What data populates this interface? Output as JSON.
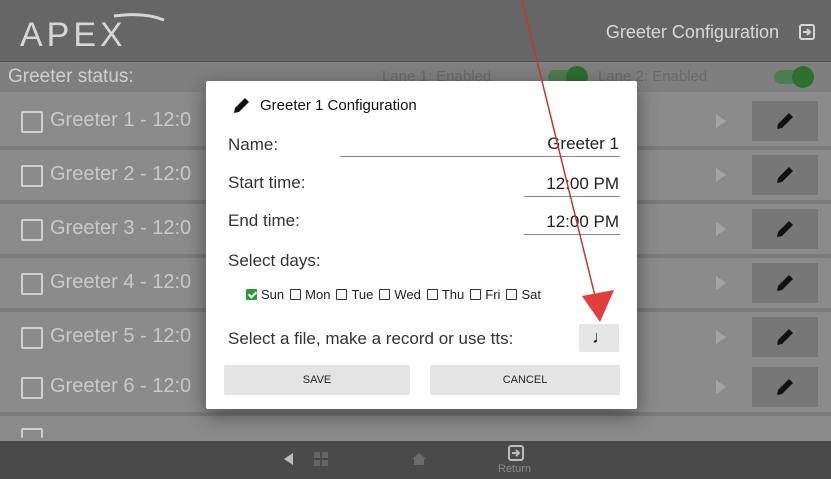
{
  "app": {
    "logo_text": "APEX",
    "title": "Greeter Configuration"
  },
  "status": {
    "label": "Greeter status:",
    "lane1": "Lane 1: Enabled",
    "lane2": "Lane 2: Enabled"
  },
  "greeters": [
    {
      "label": "Greeter 1 - 12:0"
    },
    {
      "label": "Greeter 2 - 12:0"
    },
    {
      "label": "Greeter 3 - 12:0"
    },
    {
      "label": "Greeter 4 - 12:0"
    },
    {
      "label": "Greeter 5 - 12:0"
    },
    {
      "label": "Greeter 6 - 12:0"
    }
  ],
  "dialog": {
    "title": "Greeter 1 Configuration",
    "name_label": "Name:",
    "name_value": "Greeter 1",
    "start_label": "Start time:",
    "start_value": "12:00 PM",
    "end_label": "End time:",
    "end_value": "12:00 PM",
    "days_label": "Select days:",
    "days": [
      {
        "label": "Sun",
        "checked": true
      },
      {
        "label": "Mon",
        "checked": false
      },
      {
        "label": "Tue",
        "checked": false
      },
      {
        "label": "Wed",
        "checked": false
      },
      {
        "label": "Thu",
        "checked": false
      },
      {
        "label": "Fri",
        "checked": false
      },
      {
        "label": "Sat",
        "checked": false
      }
    ],
    "file_label": "Select a file, make a record or use tts:",
    "music_icon": "music-note-icon",
    "save_label": "SAVE",
    "cancel_label": "CANCEL"
  },
  "nav": {
    "return_label": "Return"
  },
  "colors": {
    "annotation": "#e23c3c",
    "toggle_on": "#2e6e2e",
    "checkbox_checked": "#2a9d3a"
  }
}
